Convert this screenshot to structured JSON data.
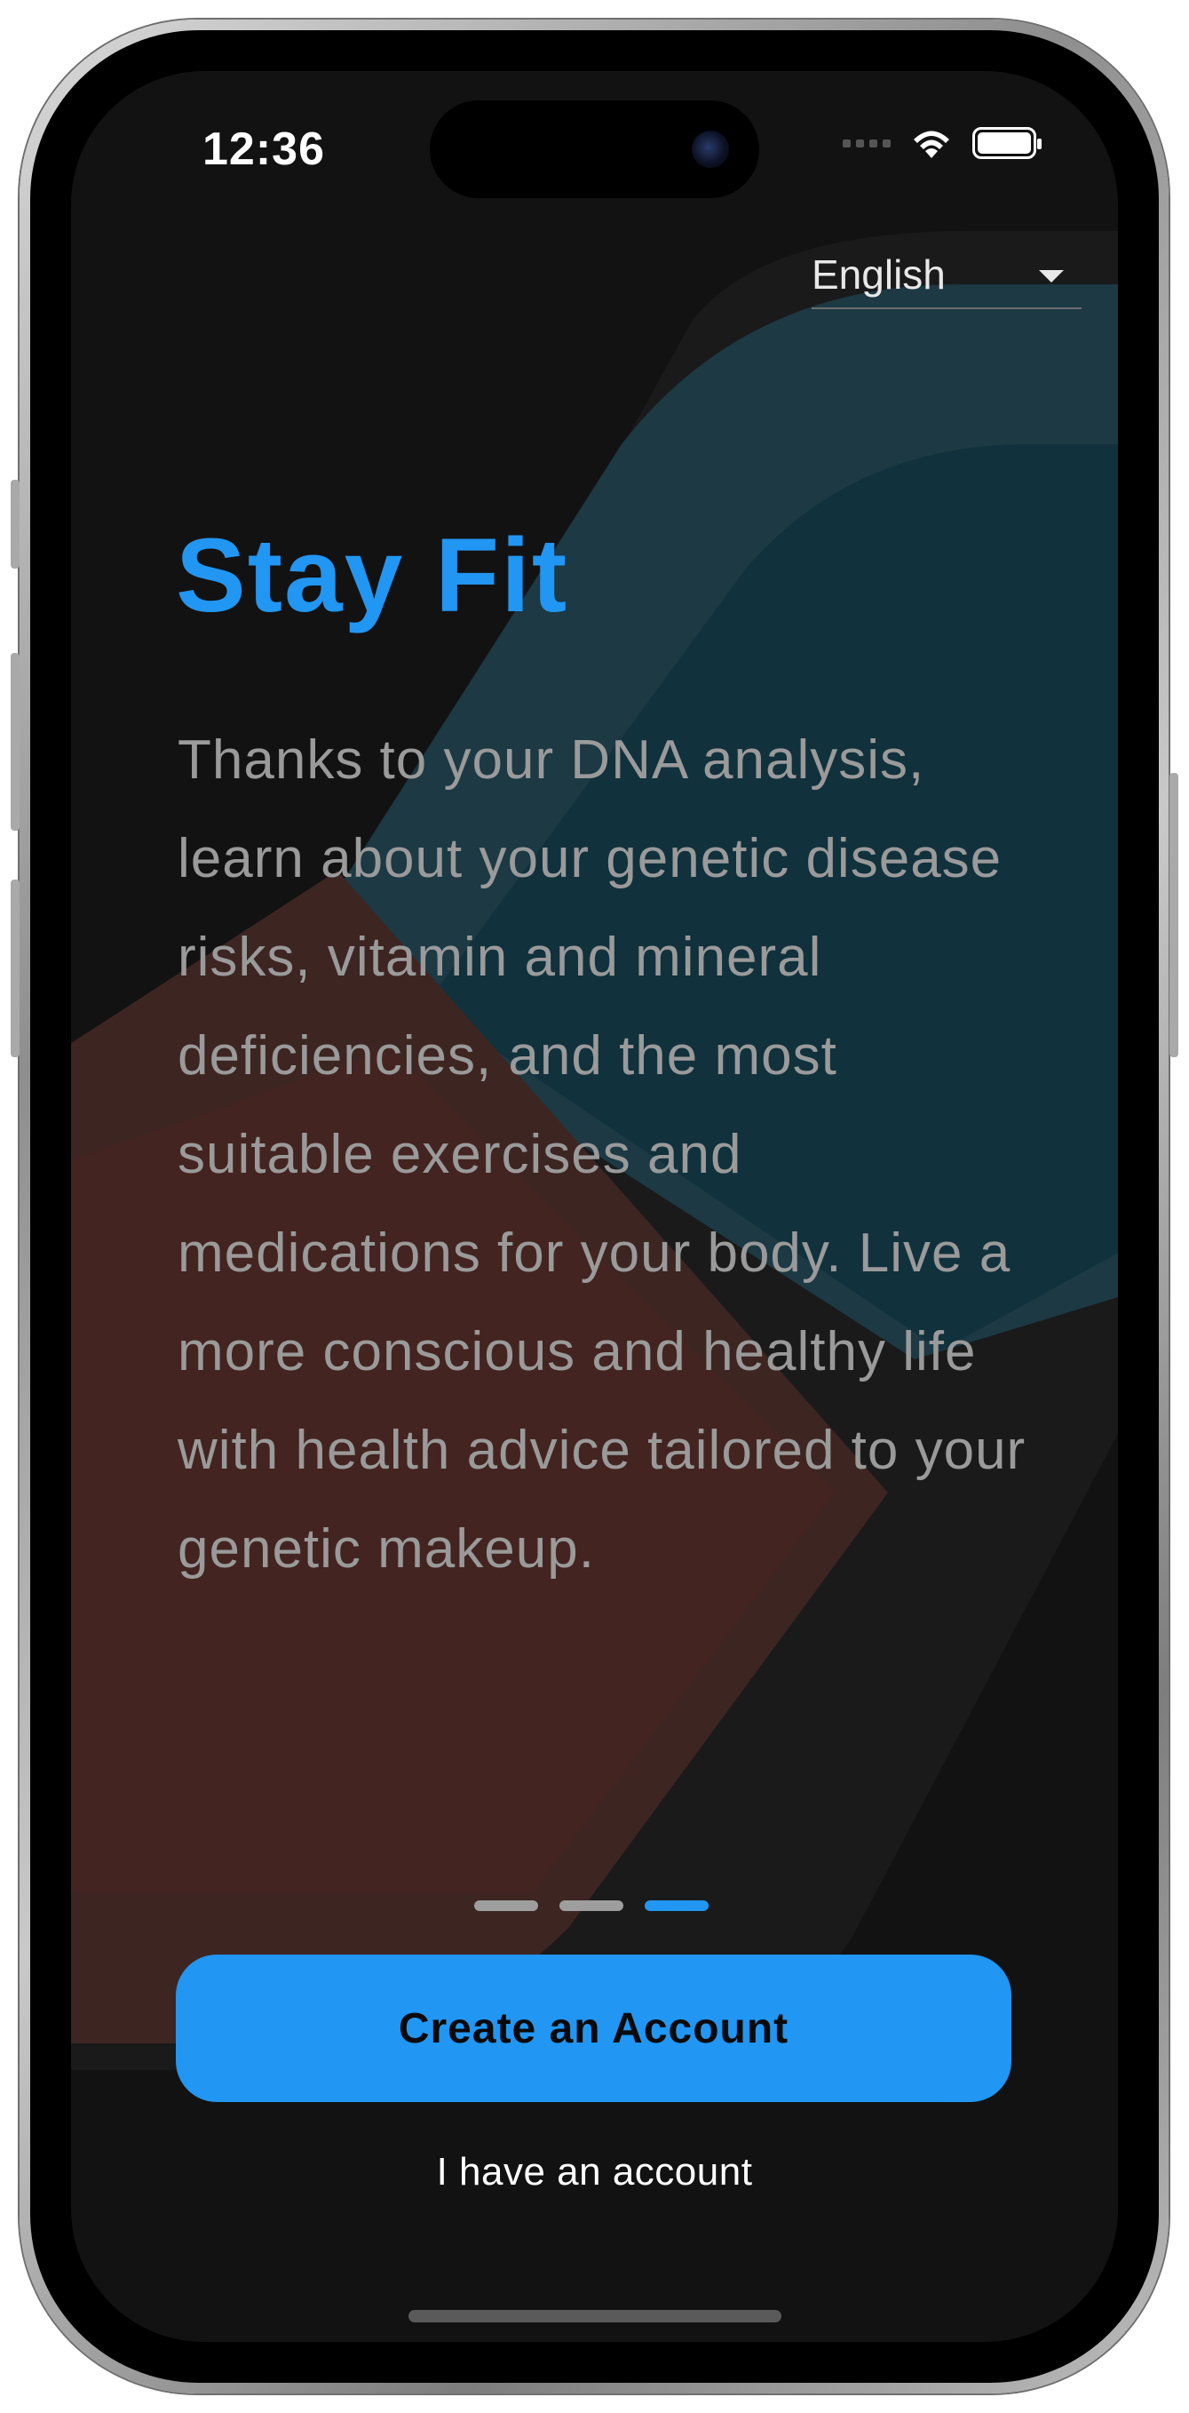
{
  "status_bar": {
    "time": "12:36",
    "icons": [
      "cellular-icon",
      "wifi-icon",
      "battery-icon"
    ]
  },
  "language_select": {
    "selected": "English",
    "icon": "caret-down-icon"
  },
  "onboarding": {
    "title": "Stay Fit",
    "description": "Thanks to your DNA analysis, learn about your genetic disease risks, vitamin and mineral deficiencies, and the most suitable exercises and medications for your body. Live a more conscious and healthy life with health advice tailored to your genetic makeup.",
    "page_count": 3,
    "current_page": 3
  },
  "actions": {
    "create_account_label": "Create an Account",
    "login_label": "I have an account"
  },
  "colors": {
    "accent": "#2196f3",
    "background": "#121212",
    "body_text": "#9a9a9a",
    "art_teal": "#1b3742",
    "art_red": "#3f2522"
  }
}
